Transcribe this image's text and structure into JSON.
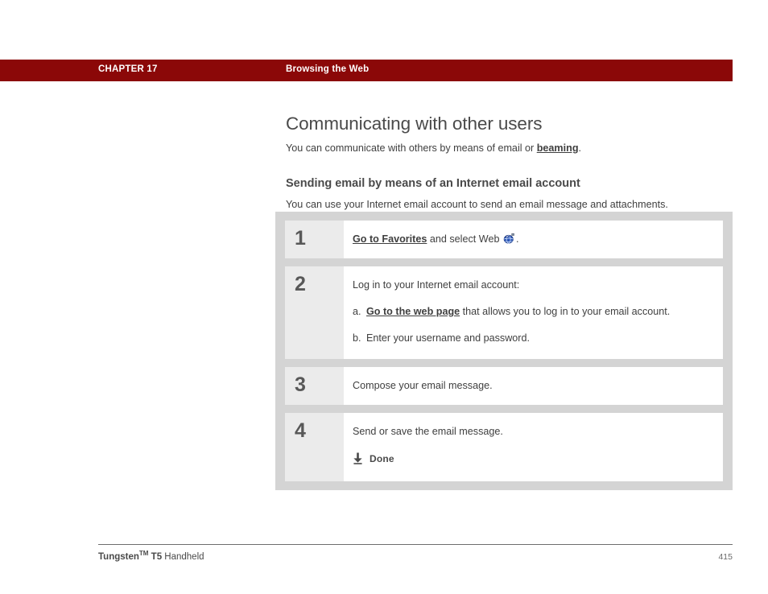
{
  "header": {
    "chapter_label": "CHAPTER 17",
    "chapter_topic": "Browsing the Web",
    "bar_color": "#8b0808"
  },
  "content": {
    "page_title": "Communicating with other users",
    "intro_prefix": "You can communicate with others by means of email or ",
    "intro_link": "beaming",
    "intro_suffix": ".",
    "section_title": "Sending email by means of an Internet email account",
    "section_intro": "You can use your Internet email account to send an email message and attachments."
  },
  "steps": [
    {
      "number": "1",
      "text_prefix": "",
      "link": "Go to Favorites",
      "text_suffix": " and select Web ",
      "icon": "web-globe-icon",
      "text_end": "."
    },
    {
      "number": "2",
      "lead": "Log in to your Internet email account:",
      "substeps": [
        {
          "marker": "a.",
          "link": "Go to the web page",
          "text": " that allows you to log in to your email account."
        },
        {
          "marker": "b.",
          "link": "",
          "text": "Enter your username and password."
        }
      ]
    },
    {
      "number": "3",
      "lead": "Compose your email message."
    },
    {
      "number": "4",
      "lead": "Send or save the email message.",
      "done_icon": "down-arrow-icon",
      "done_label": "Done"
    }
  ],
  "footer": {
    "product_name": "Tungsten",
    "trademark": "TM",
    "model": " T5",
    "product_type": " Handheld",
    "page_number": "415"
  }
}
